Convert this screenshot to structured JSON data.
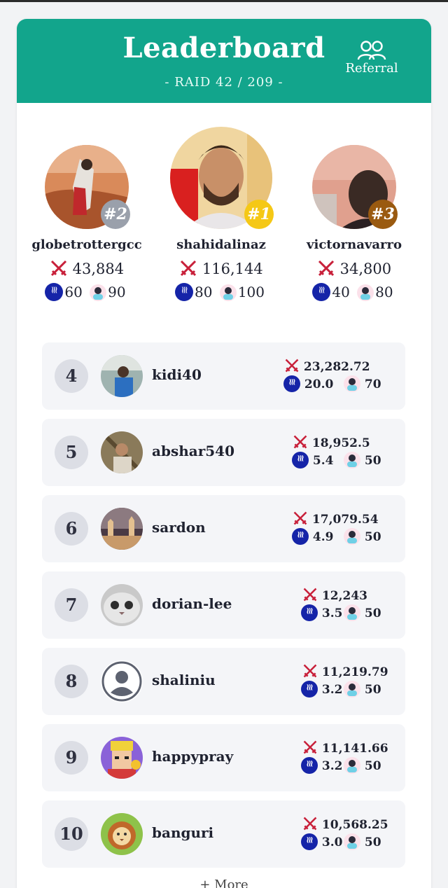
{
  "header": {
    "title": "Leaderboard",
    "subtitle": "- RAID 42 / 209 -",
    "referral_label": "Referral"
  },
  "podium": [
    {
      "rank_label": "#2",
      "name": "globetrottergcc",
      "score": "43,884",
      "sp": "60",
      "cards": "90",
      "badge_color": "#9aa0ab"
    },
    {
      "rank_label": "#1",
      "name": "shahidalinaz",
      "score": "116,144",
      "sp": "80",
      "cards": "100",
      "badge_color": "#f5c816"
    },
    {
      "rank_label": "#3",
      "name": "victornavarro",
      "score": "34,800",
      "sp": "40",
      "cards": "80",
      "badge_color": "#9a5a10"
    }
  ],
  "rows": [
    {
      "rank": "4",
      "name": "kidi40",
      "score": "23,282.72",
      "sp": "20.0",
      "cards": "70"
    },
    {
      "rank": "5",
      "name": "abshar540",
      "score": "18,952.5",
      "sp": "5.4",
      "cards": "50"
    },
    {
      "rank": "6",
      "name": "sardon",
      "score": "17,079.54",
      "sp": "4.9",
      "cards": "50"
    },
    {
      "rank": "7",
      "name": "dorian-lee",
      "score": "12,243",
      "sp": "3.5",
      "cards": "50"
    },
    {
      "rank": "8",
      "name": "shaliniu",
      "score": "11,219.79",
      "sp": "3.2",
      "cards": "50"
    },
    {
      "rank": "9",
      "name": "happypray",
      "score": "11,141.66",
      "sp": "3.2",
      "cards": "50"
    },
    {
      "rank": "10",
      "name": "banguri",
      "score": "10,568.25",
      "sp": "3.0",
      "cards": "50"
    }
  ],
  "more_label": "+ More",
  "icons": {
    "score": "crossed-swords-icon",
    "sp": "steem-coin-icon",
    "cards": "card-avatar-icon",
    "referral": "users-icon"
  },
  "colors": {
    "header": "#12a58c",
    "gold": "#f5c816",
    "silver": "#9aa0ab",
    "bronze": "#9a5a10",
    "coin": "#1524a8",
    "swords": "#c8203a"
  }
}
